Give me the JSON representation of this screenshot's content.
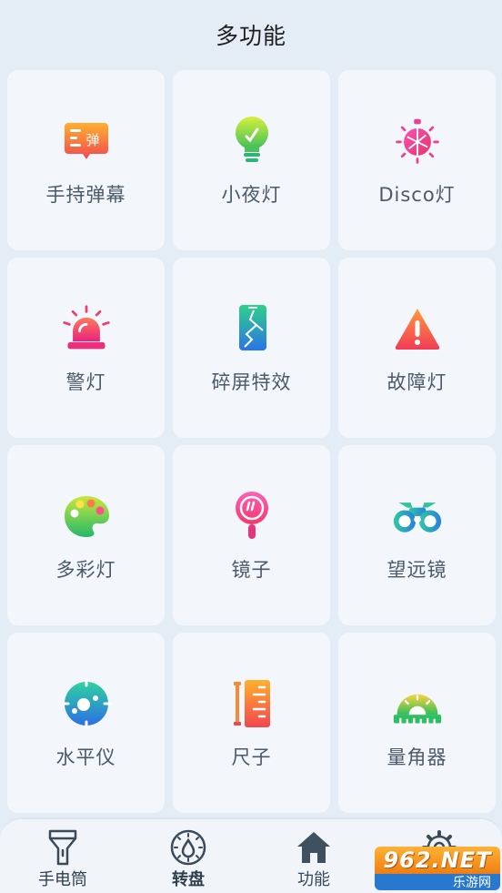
{
  "header": {
    "title": "多功能"
  },
  "tiles": [
    {
      "label": "手持弹幕",
      "icon": "danmaku-icon"
    },
    {
      "label": "小夜灯",
      "icon": "bulb-icon"
    },
    {
      "label": "Disco灯",
      "icon": "disco-ball-icon"
    },
    {
      "label": "警灯",
      "icon": "siren-icon"
    },
    {
      "label": "碎屏特效",
      "icon": "cracked-phone-icon"
    },
    {
      "label": "故障灯",
      "icon": "warning-triangle-icon"
    },
    {
      "label": "多彩灯",
      "icon": "palette-icon"
    },
    {
      "label": "镜子",
      "icon": "mirror-icon"
    },
    {
      "label": "望远镜",
      "icon": "binoculars-icon"
    },
    {
      "label": "水平仪",
      "icon": "level-icon"
    },
    {
      "label": "尺子",
      "icon": "ruler-icon"
    },
    {
      "label": "量角器",
      "icon": "protractor-icon"
    }
  ],
  "danmaku_glyph": "弹",
  "tabbar": {
    "tabs": [
      {
        "label": "手电筒",
        "icon": "flashlight-icon"
      },
      {
        "label": "转盘",
        "icon": "wheel-icon"
      },
      {
        "label": "功能",
        "icon": "home-icon",
        "active": true
      },
      {
        "label": "",
        "icon": "gear-icon"
      }
    ]
  },
  "watermark": {
    "top": "962.NET",
    "bottom": "乐游网"
  },
  "colors": {
    "background": "#e4edf6",
    "card": "#f3f7fb",
    "label": "#4b5a68"
  }
}
